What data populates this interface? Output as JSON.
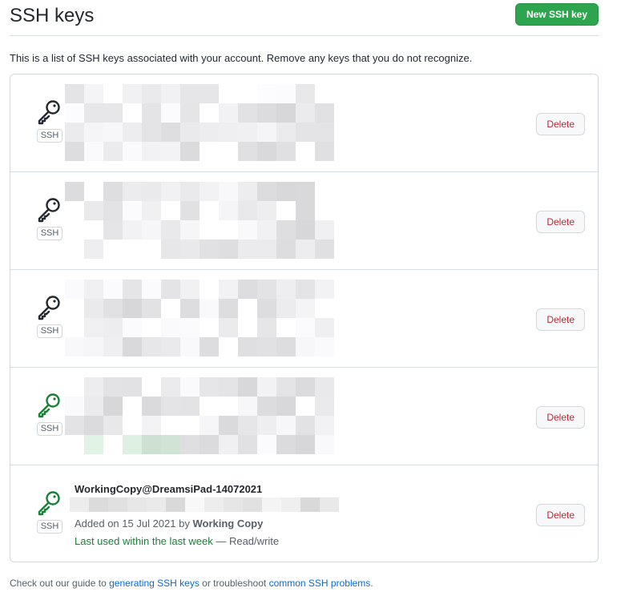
{
  "header": {
    "title": "SSH keys",
    "new_button": "New SSH key"
  },
  "intro": "This is a list of SSH keys associated with your account. Remove any keys that you do not recognize.",
  "colors": {
    "primary_green": "#2da44e",
    "danger_red": "#cf222e",
    "link_blue": "#0969da",
    "key_dark": "#24292f",
    "key_green": "#1a7f37"
  },
  "keys": [
    {
      "icon": "key-icon",
      "icon_color": "dark",
      "type_label": "SSH",
      "delete_label": "Delete"
    },
    {
      "icon": "key-icon",
      "icon_color": "dark",
      "type_label": "SSH",
      "delete_label": "Delete"
    },
    {
      "icon": "key-icon",
      "icon_color": "dark",
      "type_label": "SSH",
      "delete_label": "Delete"
    },
    {
      "icon": "key-icon",
      "icon_color": "green",
      "type_label": "SSH",
      "delete_label": "Delete"
    },
    {
      "icon": "key-icon",
      "icon_color": "green",
      "type_label": "SSH",
      "delete_label": "Delete",
      "title": "WorkingCopy@DreamsiPad-14072021",
      "added_prefix": "Added on 15 Jul 2021 by",
      "added_by": "Working Copy",
      "last_used": "Last used within the last week",
      "access": "— Read/write"
    }
  ],
  "footer": {
    "prefix": "Check out our guide to",
    "link1": "generating SSH keys",
    "middle": "or troubleshoot",
    "link2": "common SSH problems",
    "suffix": "."
  }
}
